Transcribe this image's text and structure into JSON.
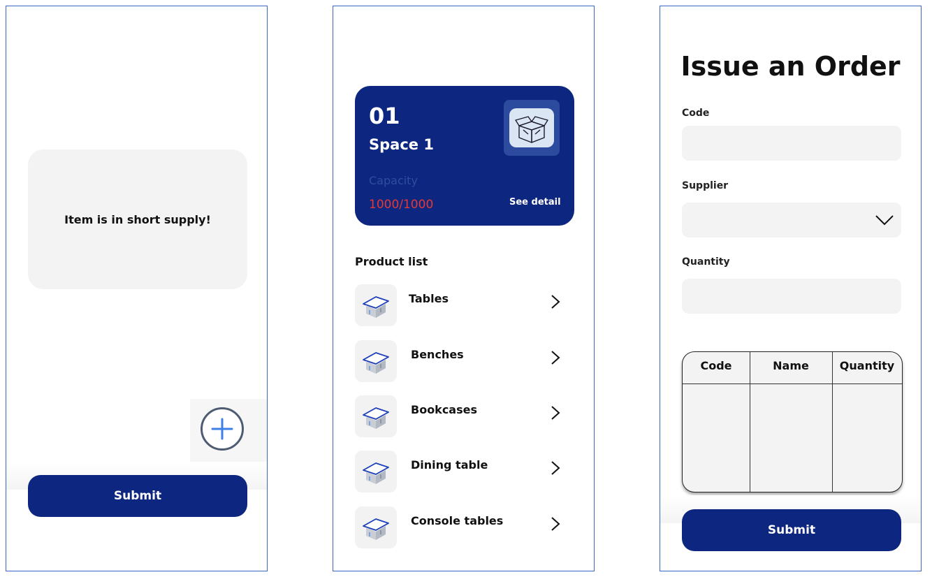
{
  "screen1": {
    "alert_text": "Item is in short supply!",
    "submit_label": "Submit",
    "add_icon": "plus-circle-icon"
  },
  "screen2": {
    "space": {
      "number": "01",
      "name": "Space 1",
      "capacity_label": "Capacity",
      "capacity_value": "1000/1000",
      "detail_link": "See detail",
      "icon": "open-box-icon"
    },
    "list_title": "Product list",
    "products": [
      {
        "label": "Tables"
      },
      {
        "label": "Benches"
      },
      {
        "label": "Bookcases"
      },
      {
        "label": "Dining table"
      },
      {
        "label": "Console tables"
      }
    ]
  },
  "screen3": {
    "title": "Issue an Order",
    "code_label": "Code",
    "code_value": "",
    "supplier_label": "Supplier",
    "supplier_value": "",
    "quantity_label": "Quantity",
    "quantity_value": "",
    "table": {
      "headers": [
        "Code",
        "Name",
        "Quantity"
      ]
    },
    "submit_label": "Submit"
  },
  "colors": {
    "primary": "#0d2680",
    "capacity_label": "#2f4e9e",
    "capacity_alert": "#e53935",
    "frame_border": "#3b66c4",
    "field_bg": "#f3f3f3"
  }
}
